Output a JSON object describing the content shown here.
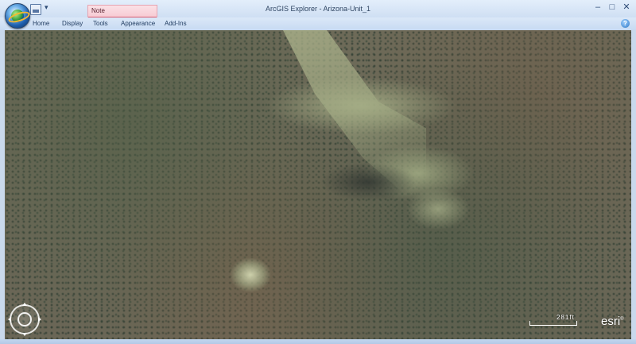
{
  "window": {
    "title": "ArcGIS Explorer - Arizona-Unit_1",
    "minimize": "–",
    "maximize": "□",
    "close": "✕"
  },
  "quick_access": {
    "dropdown": "▾"
  },
  "context_tab": {
    "label": "Note"
  },
  "ribbon": {
    "tabs": [
      "Home",
      "Display",
      "Tools",
      "Appearance",
      "Add-Ins"
    ],
    "help": "?"
  },
  "map": {
    "scale_label": "281ft",
    "logo": "esri",
    "logo_mark": "®"
  },
  "colors": {
    "context_accent": "#d85a70",
    "title_bar": "#d6e4f6"
  }
}
